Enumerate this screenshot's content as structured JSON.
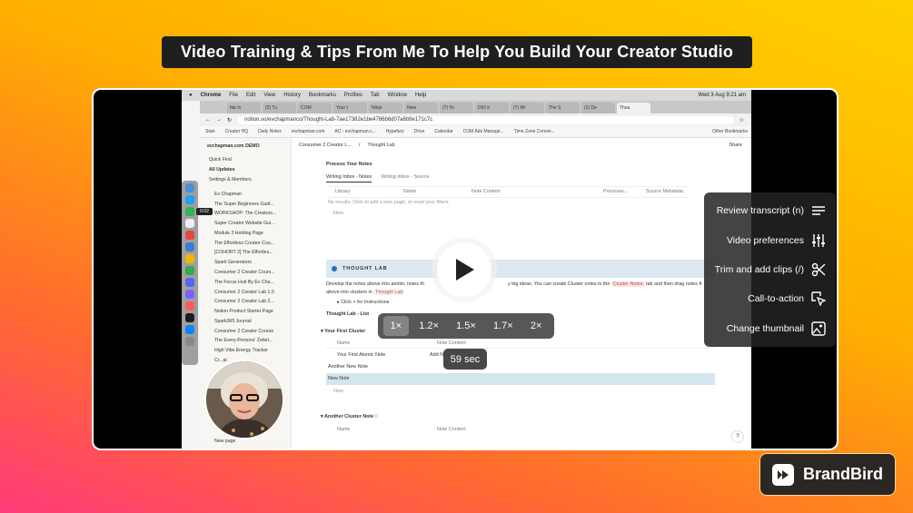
{
  "banner": {
    "title": "Video Training & Tips From Me To Help You Build Your Creator Studio"
  },
  "mac": {
    "menu": [
      "Chrome",
      "File",
      "Edit",
      "View",
      "History",
      "Bookmarks",
      "Profiles",
      "Tab",
      "Window",
      "Help"
    ],
    "clock": "Wed 3 Aug  9:21 am"
  },
  "browser": {
    "tabs": [
      "fab in",
      "(3) Tu",
      "COM",
      "Your t",
      "Ninjo",
      "New",
      "(7) Yo",
      "DIO Ir",
      "(7) Mi",
      "The S",
      "(1) De",
      "Thou"
    ],
    "url": "notion.so/evchapmanco/Thought-Lab-7ae17382e1be4766b6d07a6b9e171c7c",
    "bookmarks": [
      "Start",
      "Creator HQ",
      "Daily Notes",
      "evchapman.com",
      "AC - evchapman.c...",
      "Hypefury",
      "Drive",
      "Calendar",
      "COM Ads Manage...",
      "Time Zone Conver..."
    ],
    "bookmarks_right": "Other Bookmarks"
  },
  "notion": {
    "workspace": "evchapman.com DEMO",
    "top_items": [
      "Quick Find",
      "All Updates",
      "Settings & Members"
    ],
    "pages": [
      "Ev Chapman",
      "The Super Beginners Guid...",
      "WORKSHOP: The Creators...",
      "Super Creator Website Gui...",
      "Module 2 Holding Page",
      "The Effortless Creator Cou...",
      "[COHORT 2] The Effortles...",
      "Spark Generators",
      "Consumer 2 Creator Cours...",
      "The Focus Hub By Ev Cha...",
      "Consumer 2 Creator Lab 1.0",
      "Consumer 2 Creator Lab 2...",
      "Notion Product Starter Page",
      "Spark365 Journal",
      "Consumer 2 Creator Course",
      "The Every-Persons' Zettel...",
      "High Vibe Energy Tracker",
      "Cr...al"
    ],
    "new_page": "New page",
    "breadcrumb": [
      "Consumer 2 Creator L...",
      "Thought Lab"
    ],
    "share": "Share",
    "process_heading": "Process Your Notes",
    "view_tabs": [
      "Writing Inbox - Notes",
      "Writing Inbox - Source"
    ],
    "columns": [
      "Library",
      "Name",
      "Note Content",
      "Processe...",
      "Source Metadata"
    ],
    "no_results": "No results. Click to add a new page, or reset your filters.",
    "new_label": "New",
    "thought_lab_title": "THOUGHT LAB",
    "develop_text_a": "Develop the notes above into atomic notes th",
    "develop_text_b": "y big ideas. You can create Cluster notes in the",
    "cluster_notes_pill": "Cluster Notes",
    "develop_text_c": "tab and then drag notes fr",
    "develop_text_d": "above into clusters in",
    "thought_lab_pill": "Thought Lab",
    "click_instructions": "Click",
    "click_instructions_b": "for Instructions",
    "list_tab": "Thought Lab - List",
    "group1": "Your First Cluster",
    "name_col": "Name",
    "note_content_col": "Note Content",
    "rows": [
      "Your First Atomic Note",
      "Another New Note",
      "New Note"
    ],
    "add_note": "Add N",
    "group2": "Another Cluster Note",
    "group2_count": "0",
    "help": "?"
  },
  "player": {
    "speeds": [
      "1×",
      "1.2×",
      "1.5×",
      "1.7×",
      "2×"
    ],
    "selected_speed": "1×",
    "time_badge": "59 sec",
    "mini_timer": "0:02",
    "menu": [
      {
        "label": "Review transcript (n)",
        "icon": "transcript-lines-icon"
      },
      {
        "label": "Video preferences",
        "icon": "sliders-icon"
      },
      {
        "label": "Trim and add clips (/)",
        "icon": "scissors-icon"
      },
      {
        "label": "Call-to-action",
        "icon": "cursor-click-icon"
      },
      {
        "label": "Change thumbnail",
        "icon": "image-icon"
      }
    ]
  },
  "brand": {
    "name": "BrandBird"
  },
  "colors": {
    "accent_orange": "#ffb000",
    "banner_bg": "#1f1f1f",
    "thought_lab_bg": "#dbe8f2"
  }
}
